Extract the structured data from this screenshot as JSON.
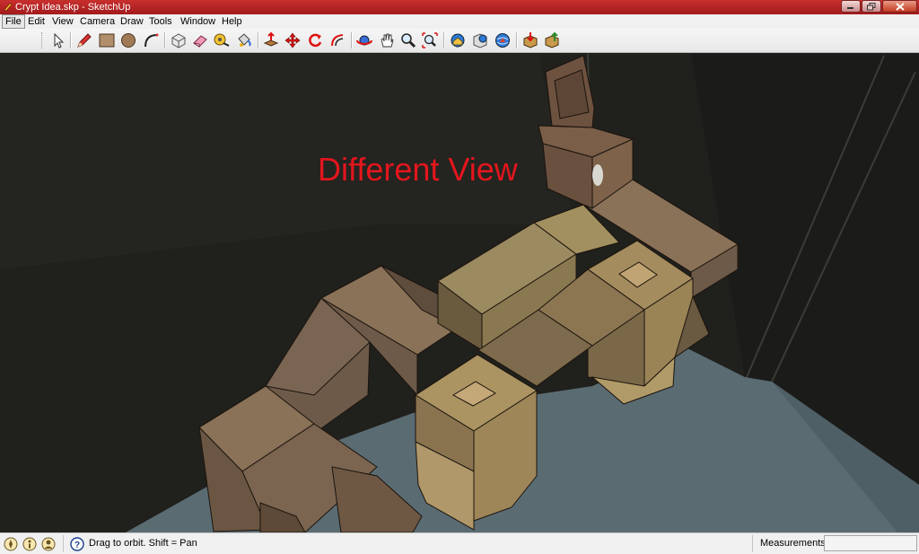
{
  "window": {
    "title": "Crypt Idea.skp - SketchUp"
  },
  "menu": {
    "items": [
      "File",
      "Edit",
      "View",
      "Camera",
      "Draw",
      "Tools",
      "Window",
      "Help"
    ],
    "active_index": 0
  },
  "toolbar": {
    "tools": [
      "select-icon",
      "pencil-icon",
      "rectangle-icon",
      "circle-icon",
      "arc-icon",
      "make-component-icon",
      "eraser-icon",
      "tape-measure-icon",
      "paint-bucket-icon",
      "push-pull-icon",
      "move-icon",
      "rotate-icon",
      "offset-icon",
      "orbit-icon",
      "pan-icon",
      "zoom-icon",
      "zoom-extents-icon",
      "get-models-icon",
      "share-model-icon",
      "3d-warehouse-icon",
      "get-components-icon",
      "share-component-icon"
    ]
  },
  "viewport": {
    "annotation": "Different View",
    "annotation_color": "#e3161d"
  },
  "status": {
    "icons": [
      "geo-location-icon",
      "credits-icon",
      "user-icon"
    ],
    "hint": "Drag to orbit.  Shift = Pan",
    "measurements_label": "Measurements",
    "measurements_value": ""
  }
}
